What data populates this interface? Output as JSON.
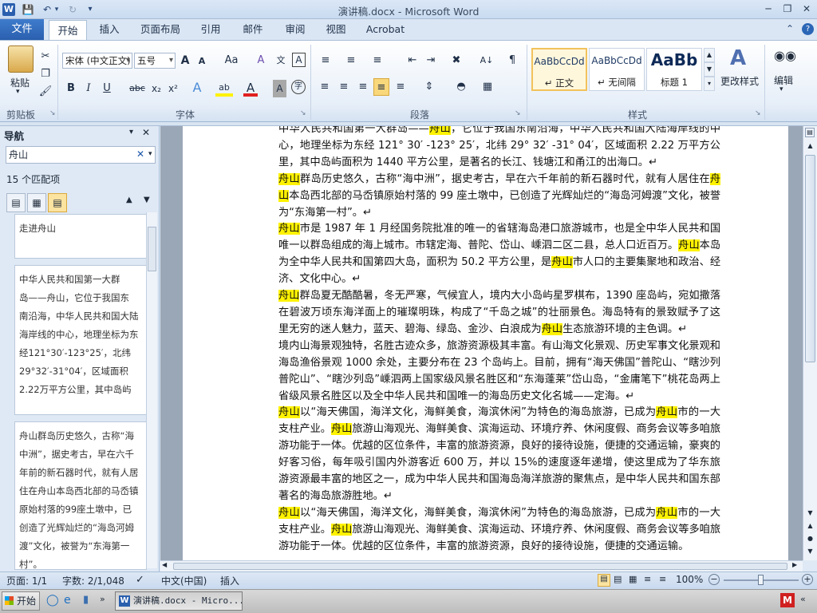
{
  "title": "演讲稿.docx - Microsoft Word",
  "tabs": {
    "file": "文件",
    "home": "开始",
    "insert": "插入",
    "layout": "页面布局",
    "references": "引用",
    "mail": "邮件",
    "review": "审阅",
    "view": "视图",
    "acrobat": "Acrobat"
  },
  "ribbon": {
    "paste": "粘贴",
    "clipboard": "剪贴板",
    "font_group": "字体",
    "paragraph_group": "段落",
    "styles_group": "样式",
    "font_name": "宋体 (中文正文)",
    "font_size": "五号",
    "styles": [
      {
        "preview": "AaBbCcDd",
        "name": "↵ 正文"
      },
      {
        "preview": "AaBbCcDd",
        "name": "↵ 无间隔"
      },
      {
        "preview": "AaBb",
        "name": "标题 1"
      }
    ],
    "change_styles": "更改样式",
    "edit": "编辑",
    "grow_font": "A",
    "shrink_font": "A",
    "change_case": "Aa",
    "clear_format": "A",
    "bold": "B",
    "italic": "I",
    "underline": "U",
    "strike": "abc",
    "sub": "x₂",
    "sup": "x²",
    "text_effect": "A",
    "highlight": "ab",
    "font_color": "A",
    "char_shade": "A",
    "enclose": "字"
  },
  "nav": {
    "title": "导航",
    "query": "舟山",
    "matches": "15 个匹配项",
    "results": [
      {
        "lines": [
          "走进舟山"
        ]
      },
      {
        "lines": [
          "中华人民共和国第一大群",
          "岛——舟山，它位于我国东",
          "南沿海，中华人民共和国大陆",
          "海岸线的中心，地理坐标为东",
          "经121°30′-123°25′，北纬",
          "29°32′-31°04′，区域面积",
          "2.22万平方公里，其中岛屿"
        ]
      },
      {
        "lines": [
          "舟山群岛历史悠久，古称“海",
          "中洲”，据史考古，早在六千",
          "年前的新石器时代，就有人居",
          "住在舟山本岛西北部的马岙镇",
          "原始村落的99座土墩中，已",
          "创造了光辉灿烂的“海岛河姆",
          "渡”文化，被誉为“东海第一",
          "村”。"
        ]
      }
    ]
  },
  "document": {
    "paragraphs": [
      [
        {
          "t": "中华人民共和国第一大群岛——"
        },
        {
          "t": "舟山",
          "hl": true
        },
        {
          "t": "，它位于我国东南沿海，中华人民共和国大陆海岸线的中心，地理坐标为东经 121° 30′ -123° 25′，北纬 29° 32′ -31° 04′，区域面积 2.22 万平方公里，其中岛屿面积为 1440 平方公里，是著名的长江、钱塘江和甬江的出海口。↵"
        }
      ],
      [
        {
          "t": "舟山",
          "hl": true
        },
        {
          "t": "群岛历史悠久，古称“海中洲”，据史考古，早在六千年前的新石器时代，就有人居住在"
        },
        {
          "t": "舟山",
          "hl": true
        },
        {
          "t": "本岛西北部的马岙镇原始村落的 99 座土墩中，已创造了光辉灿烂的“海岛河姆渡”文化，被誉为“东海第一村”。↵"
        }
      ],
      [
        {
          "t": "舟山",
          "hl": true
        },
        {
          "t": "市是 1987 年 1 月经国务院批准的唯一的省辖海岛港口旅游城市，也是全中华人民共和国唯一以群岛组成的海上城市。市辖定海、普陀、岱山、嵊泗二区二县，总人口近百万。"
        },
        {
          "t": "舟山",
          "hl": true
        },
        {
          "t": "本岛为全中华人民共和国第四大岛，面积为 50.2 平方公里，是"
        },
        {
          "t": "舟山",
          "hl": true
        },
        {
          "t": "市人口的主要集聚地和政治、经济、文化中心。↵"
        }
      ],
      [
        {
          "t": "舟山",
          "hl": true
        },
        {
          "t": "群岛夏无酷酷暑，冬无严寒，气候宜人，境内大小岛屿星罗棋布，1390 座岛屿，宛如撒落在碧波万顷东海洋面上的璀璨明珠，构成了“千岛之城”的壮丽景色。海岛特有的景致赋予了这里无穷的迷人魅力，蓝天、碧海、绿岛、金沙、白浪成为"
        },
        {
          "t": "舟山",
          "hl": true
        },
        {
          "t": "生态旅游环境的主色调。↵"
        }
      ],
      [
        {
          "t": "境内山海景观独特，名胜古迹众多，旅游资源极其丰富。有山海文化景观、历史军事文化景观和海岛渔俗景观 1000 余处，主要分布在 23 个岛屿上。目前，拥有“海天佛国”普陀山、“瞎沙列普陀山”、“瞎沙列岛”嵊泗两上国家级风景名胜区和“东海蓬莱”岱山岛，“金庸笔下”桃花岛两上省级风景名胜区以及全中华人民共和国唯一的海岛历史文化名城——定海。↵"
        }
      ],
      [
        {
          "t": "舟山",
          "hl": true
        },
        {
          "t": "以“海天佛国，海洋文化，海鲜美食，海滨休闲”为特色的海岛旅游，已成为"
        },
        {
          "t": "舟山",
          "hl": true
        },
        {
          "t": "市的一大支柱产业。"
        },
        {
          "t": "舟山",
          "hl": true
        },
        {
          "t": "旅游山海观光、海鲜美食、滨海运动、环境疗养、休闲度假、商务会议等多咱旅游功能于一体。优越的区位条件，丰富的旅游资源，良好的接待设施，便捷的交通运输，豪爽的好客习俗，每年吸引国内外游客近 600 万，并以 15%的速度逐年递增，使这里成为了华东旅游资源最丰富的地区之一，成为中华人民共和国海岛海洋旅游的聚焦点，是中华人民共和国东部著名的海岛旅游胜地。↵"
        }
      ],
      [
        {
          "t": "舟山",
          "hl": true
        },
        {
          "t": "以“海天佛国，海洋文化，海鲜美食，海滨休闲”为特色的海岛旅游，已成为"
        },
        {
          "t": "舟山",
          "hl": true
        },
        {
          "t": "市的一大支柱产业。"
        },
        {
          "t": "舟山",
          "hl": true
        },
        {
          "t": "旅游山海观光、海鲜美食、滨海运动、环境疗养、休闲度假、商务会议等多咱旅游功能于一体。优越的区位条件，丰富的旅游资源，良好的接待设施，便捷的交通运输。"
        }
      ]
    ]
  },
  "status": {
    "page": "页面: 1/1",
    "words": "字数: 2/1,048",
    "lang": "中文(中国)",
    "mode": "插入",
    "zoom": "100%"
  },
  "taskbar": {
    "start": "开始",
    "task": "演讲稿.docx - Micro..."
  },
  "colors": {
    "highlight": "#fff200",
    "file_tab": "#2a5fae",
    "ribbon_bg": "#e6eef8"
  }
}
